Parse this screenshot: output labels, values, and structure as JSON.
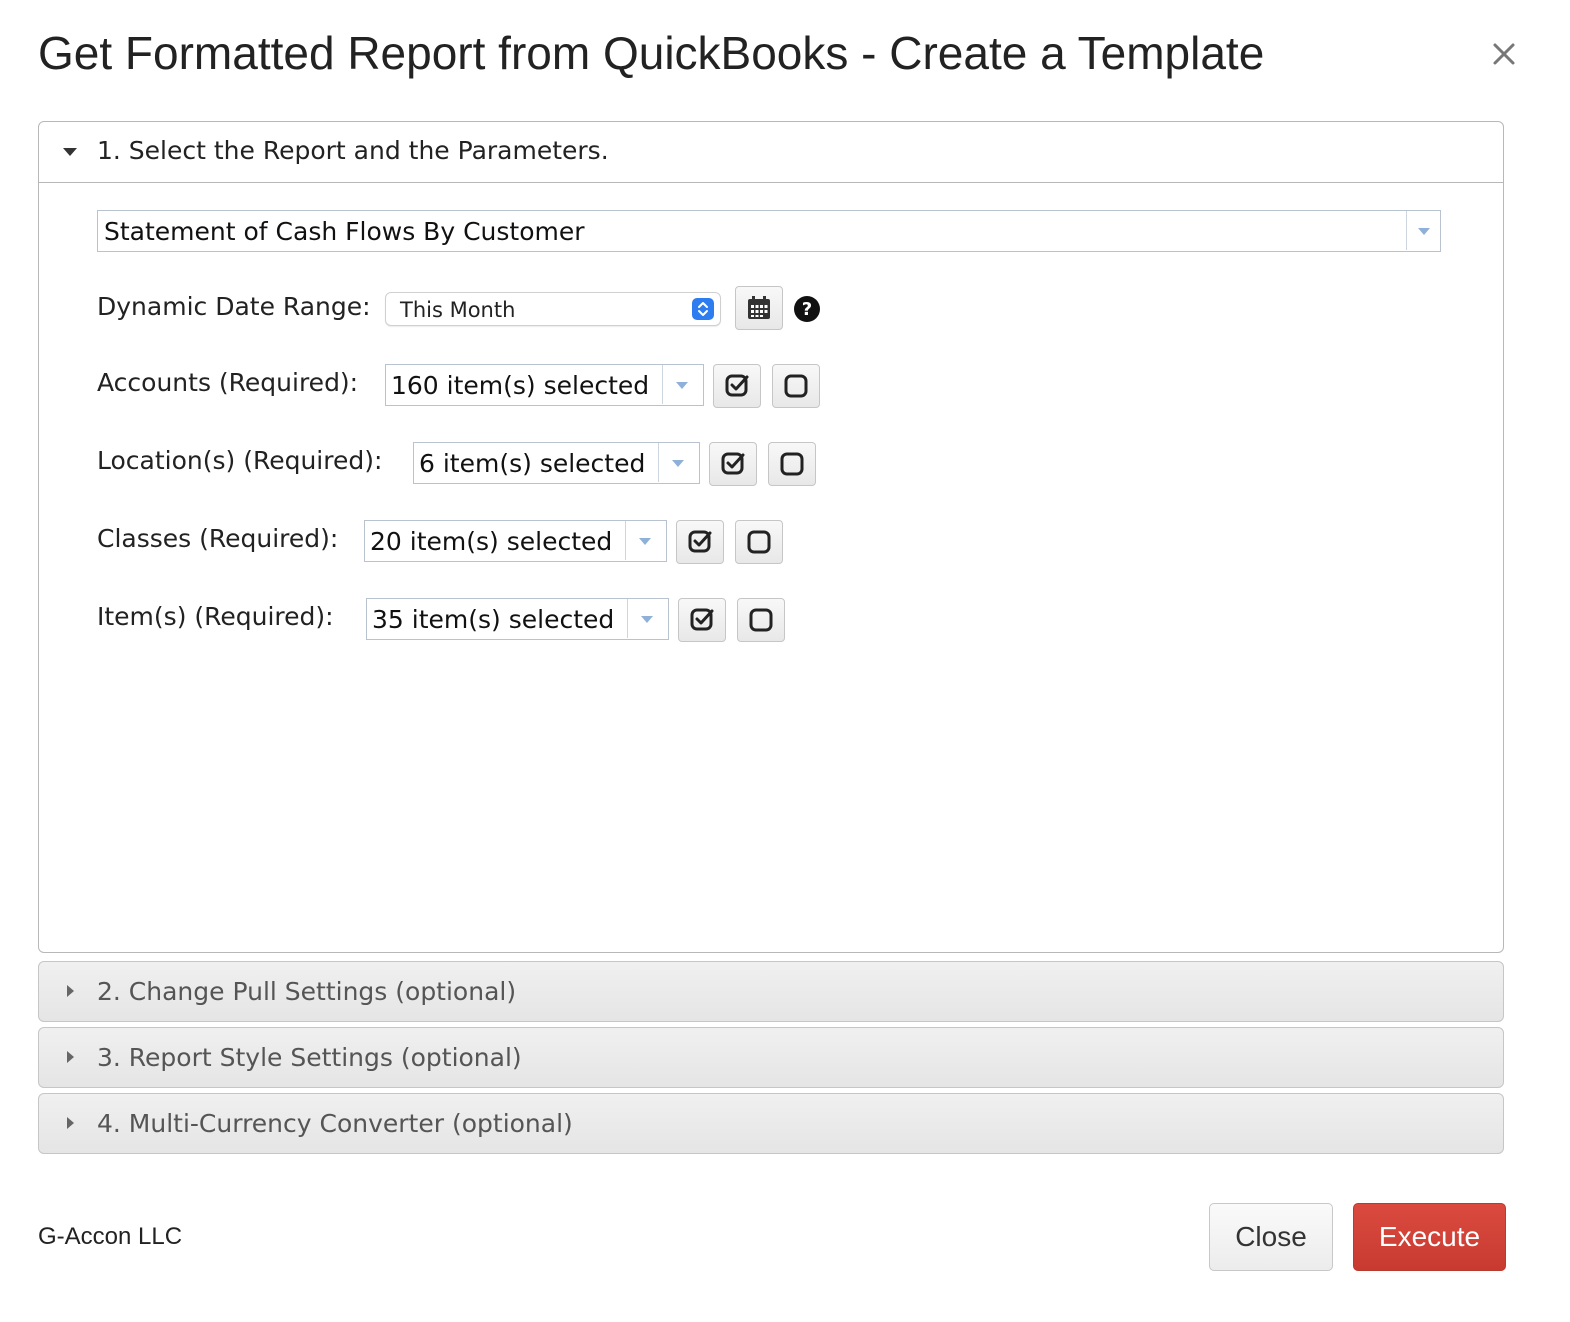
{
  "dialog": {
    "title": "Get Formatted Report from QuickBooks - Create a Template"
  },
  "sections": [
    {
      "label": "1. Select the Report and the Parameters.",
      "expanded": true
    },
    {
      "label": "2. Change Pull Settings (optional)",
      "expanded": false
    },
    {
      "label": "3. Report Style Settings (optional)",
      "expanded": false
    },
    {
      "label": "4. Multi-Currency Converter (optional)",
      "expanded": false
    }
  ],
  "report": {
    "selected": "Statement of Cash Flows By Customer"
  },
  "date_range": {
    "label": "Dynamic Date Range:",
    "value": "This Month"
  },
  "filters": [
    {
      "label": "Accounts (Required):",
      "value": "160 item(s) selected"
    },
    {
      "label": "Location(s) (Required):",
      "value": "6 item(s) selected"
    },
    {
      "label": "Classes (Required):",
      "value": "20 item(s) selected"
    },
    {
      "label": "Item(s) (Required):",
      "value": "35 item(s) selected"
    }
  ],
  "footer": {
    "company": "G-Accon LLC",
    "close_label": "Close",
    "execute_label": "Execute"
  },
  "colors": {
    "execute_button": "#d44236",
    "stepper_accent": "#2d7cf0"
  },
  "icons": [
    "close-icon",
    "calendar-icon",
    "help-icon",
    "select-all-icon",
    "deselect-all-icon"
  ]
}
